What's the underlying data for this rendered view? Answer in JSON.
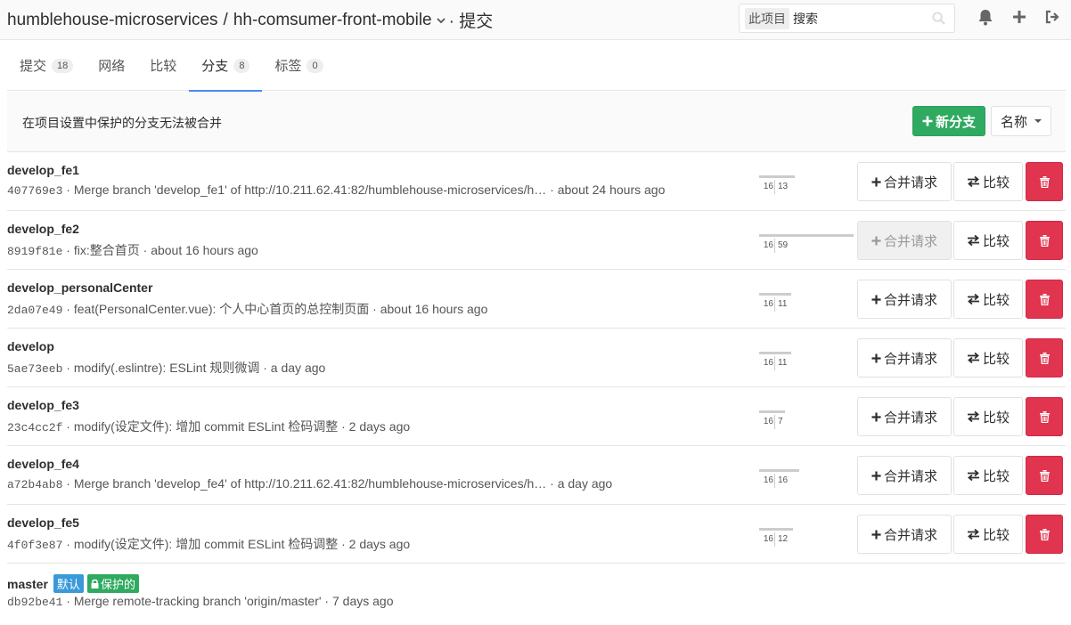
{
  "header": {
    "namespace": "humblehouse-microservices",
    "separator": "/",
    "project": "hh-comsumer-front-mobile",
    "section": "· 提交",
    "search_scope": "此项目",
    "search_placeholder": "搜索"
  },
  "tabs": [
    {
      "label": "提交",
      "count": "18"
    },
    {
      "label": "网络",
      "count": null
    },
    {
      "label": "比较",
      "count": null
    },
    {
      "label": "分支",
      "count": "8",
      "active": true
    },
    {
      "label": "标签",
      "count": "0"
    }
  ],
  "infobar": {
    "message": "在项目设置中保护的分支无法被合并",
    "new_branch_label": "新分支",
    "sort_label": "名称"
  },
  "actions": {
    "merge_label": "合并请求",
    "compare_label": "比较"
  },
  "branches": [
    {
      "name": "develop_fe1",
      "sha": "407769e3",
      "message": " · Merge branch 'develop_fe1' of http://10.211.62.41:82/humblehouse-microservices/h… · about 24 hours ago",
      "behind": "16",
      "ahead": "13",
      "behind_val": 16,
      "ahead_val": 13,
      "merge_disabled": false
    },
    {
      "name": "develop_fe2",
      "sha": "8919f81e",
      "message": " · fix:整合首页 · about 16 hours ago",
      "behind": "16",
      "ahead": "59",
      "behind_val": 16,
      "ahead_val": 59,
      "merge_disabled": true
    },
    {
      "name": "develop_personalCenter",
      "sha": "2da07e49",
      "message": " · feat(PersonalCenter.vue): 个人中心首页的总控制页面 · about 16 hours ago",
      "behind": "16",
      "ahead": "11",
      "behind_val": 16,
      "ahead_val": 11,
      "merge_disabled": false
    },
    {
      "name": "develop",
      "sha": "5ae73eeb",
      "message": " · modify(.eslintre): ESLint 规则微调 · a day ago",
      "behind": "16",
      "ahead": "11",
      "behind_val": 16,
      "ahead_val": 11,
      "merge_disabled": false
    },
    {
      "name": "develop_fe3",
      "sha": "23c4cc2f",
      "message": " · modify(设定文件): 增加 commit ESLint 检码调整 · 2 days ago",
      "behind": "16",
      "ahead": "7",
      "behind_val": 16,
      "ahead_val": 7,
      "merge_disabled": false
    },
    {
      "name": "develop_fe4",
      "sha": "a72b4ab8",
      "message": " · Merge branch 'develop_fe4' of http://10.211.62.41:82/humblehouse-microservices/h… · a day ago",
      "behind": "16",
      "ahead": "16",
      "behind_val": 16,
      "ahead_val": 16,
      "merge_disabled": false
    },
    {
      "name": "develop_fe5",
      "sha": "4f0f3e87",
      "message": " · modify(设定文件): 增加 commit ESLint 检码调整 · 2 days ago",
      "behind": "16",
      "ahead": "12",
      "behind_val": 16,
      "ahead_val": 12,
      "merge_disabled": false
    }
  ],
  "master": {
    "name": "master",
    "default_label": "默认",
    "protected_label": "保护的",
    "sha": "db92be41",
    "message": " · Merge remote-tracking branch 'origin/master' · 7 days ago"
  },
  "icons": {
    "search": "search-icon",
    "bell": "bell-icon",
    "plus": "plus-icon",
    "signout": "sign-out-icon",
    "trash": "trash-icon",
    "exchange": "exchange-icon",
    "lock": "lock-icon"
  },
  "colors": {
    "green": "#2faa60",
    "red": "#e0344f",
    "blue": "#3a9ad9",
    "active_tab": "#4a8bee"
  }
}
